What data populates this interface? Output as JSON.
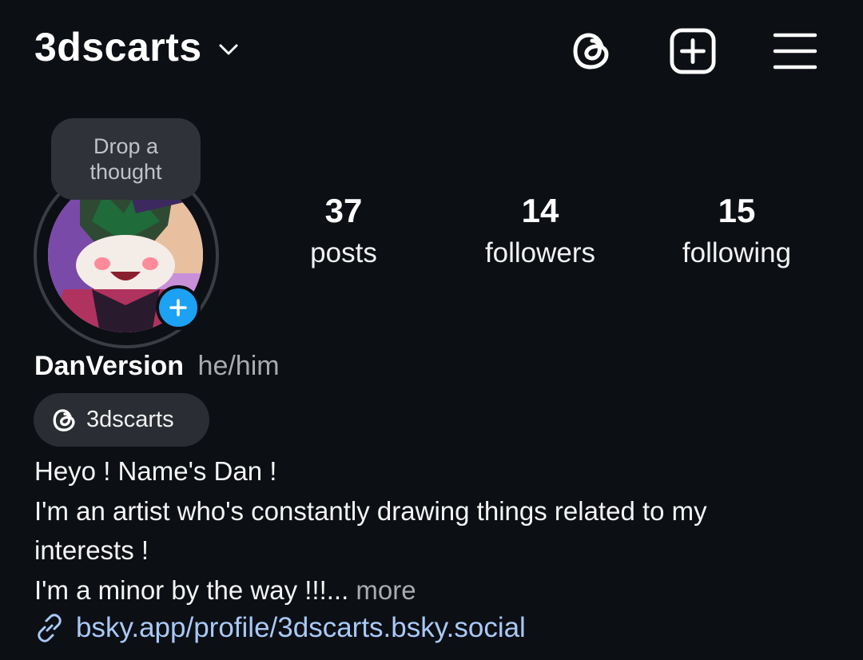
{
  "header": {
    "username": "3dscarts"
  },
  "icons": {
    "dropdown": "chevron-down-icon",
    "threads": "threads-icon",
    "create": "plus-square-icon",
    "menu": "hamburger-menu-icon",
    "add_story": "plus-icon",
    "link": "link-icon"
  },
  "note": {
    "line1": "Drop a",
    "line2": "thought"
  },
  "stats": {
    "posts": {
      "value": "37",
      "label": "posts"
    },
    "followers": {
      "value": "14",
      "label": "followers"
    },
    "following": {
      "value": "15",
      "label": "following"
    }
  },
  "profile": {
    "display_name": "DanVersion",
    "pronouns": "he/him",
    "threads_handle": "3dscarts"
  },
  "bio": {
    "line1": "Heyo ! Name's Dan !",
    "line2": "I'm an artist who's constantly drawing things related to my",
    "line3": "interests !",
    "line4": "I'm a minor by the way !!!...",
    "more": " more",
    "link": "bsky.app/profile/3dscarts.bsky.social"
  },
  "colors": {
    "background": "#0c0f14",
    "link": "#a9c9f6",
    "add_story_badge": "#1da1f2",
    "chip": "#2a2d33"
  }
}
